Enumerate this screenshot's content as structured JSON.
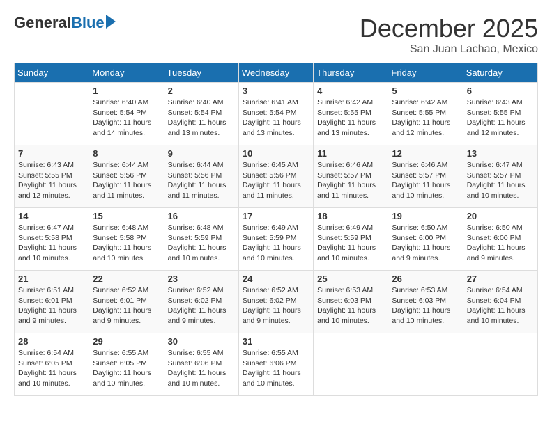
{
  "header": {
    "logo_general": "General",
    "logo_blue": "Blue",
    "title": "December 2025",
    "location": "San Juan Lachao, Mexico"
  },
  "days_of_week": [
    "Sunday",
    "Monday",
    "Tuesday",
    "Wednesday",
    "Thursday",
    "Friday",
    "Saturday"
  ],
  "weeks": [
    [
      {
        "day": "",
        "sunrise": "",
        "sunset": "",
        "daylight": ""
      },
      {
        "day": "1",
        "sunrise": "Sunrise: 6:40 AM",
        "sunset": "Sunset: 5:54 PM",
        "daylight": "Daylight: 11 hours and 14 minutes."
      },
      {
        "day": "2",
        "sunrise": "Sunrise: 6:40 AM",
        "sunset": "Sunset: 5:54 PM",
        "daylight": "Daylight: 11 hours and 13 minutes."
      },
      {
        "day": "3",
        "sunrise": "Sunrise: 6:41 AM",
        "sunset": "Sunset: 5:54 PM",
        "daylight": "Daylight: 11 hours and 13 minutes."
      },
      {
        "day": "4",
        "sunrise": "Sunrise: 6:42 AM",
        "sunset": "Sunset: 5:55 PM",
        "daylight": "Daylight: 11 hours and 13 minutes."
      },
      {
        "day": "5",
        "sunrise": "Sunrise: 6:42 AM",
        "sunset": "Sunset: 5:55 PM",
        "daylight": "Daylight: 11 hours and 12 minutes."
      },
      {
        "day": "6",
        "sunrise": "Sunrise: 6:43 AM",
        "sunset": "Sunset: 5:55 PM",
        "daylight": "Daylight: 11 hours and 12 minutes."
      }
    ],
    [
      {
        "day": "7",
        "sunrise": "Sunrise: 6:43 AM",
        "sunset": "Sunset: 5:55 PM",
        "daylight": "Daylight: 11 hours and 12 minutes."
      },
      {
        "day": "8",
        "sunrise": "Sunrise: 6:44 AM",
        "sunset": "Sunset: 5:56 PM",
        "daylight": "Daylight: 11 hours and 11 minutes."
      },
      {
        "day": "9",
        "sunrise": "Sunrise: 6:44 AM",
        "sunset": "Sunset: 5:56 PM",
        "daylight": "Daylight: 11 hours and 11 minutes."
      },
      {
        "day": "10",
        "sunrise": "Sunrise: 6:45 AM",
        "sunset": "Sunset: 5:56 PM",
        "daylight": "Daylight: 11 hours and 11 minutes."
      },
      {
        "day": "11",
        "sunrise": "Sunrise: 6:46 AM",
        "sunset": "Sunset: 5:57 PM",
        "daylight": "Daylight: 11 hours and 11 minutes."
      },
      {
        "day": "12",
        "sunrise": "Sunrise: 6:46 AM",
        "sunset": "Sunset: 5:57 PM",
        "daylight": "Daylight: 11 hours and 10 minutes."
      },
      {
        "day": "13",
        "sunrise": "Sunrise: 6:47 AM",
        "sunset": "Sunset: 5:57 PM",
        "daylight": "Daylight: 11 hours and 10 minutes."
      }
    ],
    [
      {
        "day": "14",
        "sunrise": "Sunrise: 6:47 AM",
        "sunset": "Sunset: 5:58 PM",
        "daylight": "Daylight: 11 hours and 10 minutes."
      },
      {
        "day": "15",
        "sunrise": "Sunrise: 6:48 AM",
        "sunset": "Sunset: 5:58 PM",
        "daylight": "Daylight: 11 hours and 10 minutes."
      },
      {
        "day": "16",
        "sunrise": "Sunrise: 6:48 AM",
        "sunset": "Sunset: 5:59 PM",
        "daylight": "Daylight: 11 hours and 10 minutes."
      },
      {
        "day": "17",
        "sunrise": "Sunrise: 6:49 AM",
        "sunset": "Sunset: 5:59 PM",
        "daylight": "Daylight: 11 hours and 10 minutes."
      },
      {
        "day": "18",
        "sunrise": "Sunrise: 6:49 AM",
        "sunset": "Sunset: 5:59 PM",
        "daylight": "Daylight: 11 hours and 10 minutes."
      },
      {
        "day": "19",
        "sunrise": "Sunrise: 6:50 AM",
        "sunset": "Sunset: 6:00 PM",
        "daylight": "Daylight: 11 hours and 9 minutes."
      },
      {
        "day": "20",
        "sunrise": "Sunrise: 6:50 AM",
        "sunset": "Sunset: 6:00 PM",
        "daylight": "Daylight: 11 hours and 9 minutes."
      }
    ],
    [
      {
        "day": "21",
        "sunrise": "Sunrise: 6:51 AM",
        "sunset": "Sunset: 6:01 PM",
        "daylight": "Daylight: 11 hours and 9 minutes."
      },
      {
        "day": "22",
        "sunrise": "Sunrise: 6:52 AM",
        "sunset": "Sunset: 6:01 PM",
        "daylight": "Daylight: 11 hours and 9 minutes."
      },
      {
        "day": "23",
        "sunrise": "Sunrise: 6:52 AM",
        "sunset": "Sunset: 6:02 PM",
        "daylight": "Daylight: 11 hours and 9 minutes."
      },
      {
        "day": "24",
        "sunrise": "Sunrise: 6:52 AM",
        "sunset": "Sunset: 6:02 PM",
        "daylight": "Daylight: 11 hours and 9 minutes."
      },
      {
        "day": "25",
        "sunrise": "Sunrise: 6:53 AM",
        "sunset": "Sunset: 6:03 PM",
        "daylight": "Daylight: 11 hours and 10 minutes."
      },
      {
        "day": "26",
        "sunrise": "Sunrise: 6:53 AM",
        "sunset": "Sunset: 6:03 PM",
        "daylight": "Daylight: 11 hours and 10 minutes."
      },
      {
        "day": "27",
        "sunrise": "Sunrise: 6:54 AM",
        "sunset": "Sunset: 6:04 PM",
        "daylight": "Daylight: 11 hours and 10 minutes."
      }
    ],
    [
      {
        "day": "28",
        "sunrise": "Sunrise: 6:54 AM",
        "sunset": "Sunset: 6:05 PM",
        "daylight": "Daylight: 11 hours and 10 minutes."
      },
      {
        "day": "29",
        "sunrise": "Sunrise: 6:55 AM",
        "sunset": "Sunset: 6:05 PM",
        "daylight": "Daylight: 11 hours and 10 minutes."
      },
      {
        "day": "30",
        "sunrise": "Sunrise: 6:55 AM",
        "sunset": "Sunset: 6:06 PM",
        "daylight": "Daylight: 11 hours and 10 minutes."
      },
      {
        "day": "31",
        "sunrise": "Sunrise: 6:55 AM",
        "sunset": "Sunset: 6:06 PM",
        "daylight": "Daylight: 11 hours and 10 minutes."
      },
      {
        "day": "",
        "sunrise": "",
        "sunset": "",
        "daylight": ""
      },
      {
        "day": "",
        "sunrise": "",
        "sunset": "",
        "daylight": ""
      },
      {
        "day": "",
        "sunrise": "",
        "sunset": "",
        "daylight": ""
      }
    ]
  ]
}
